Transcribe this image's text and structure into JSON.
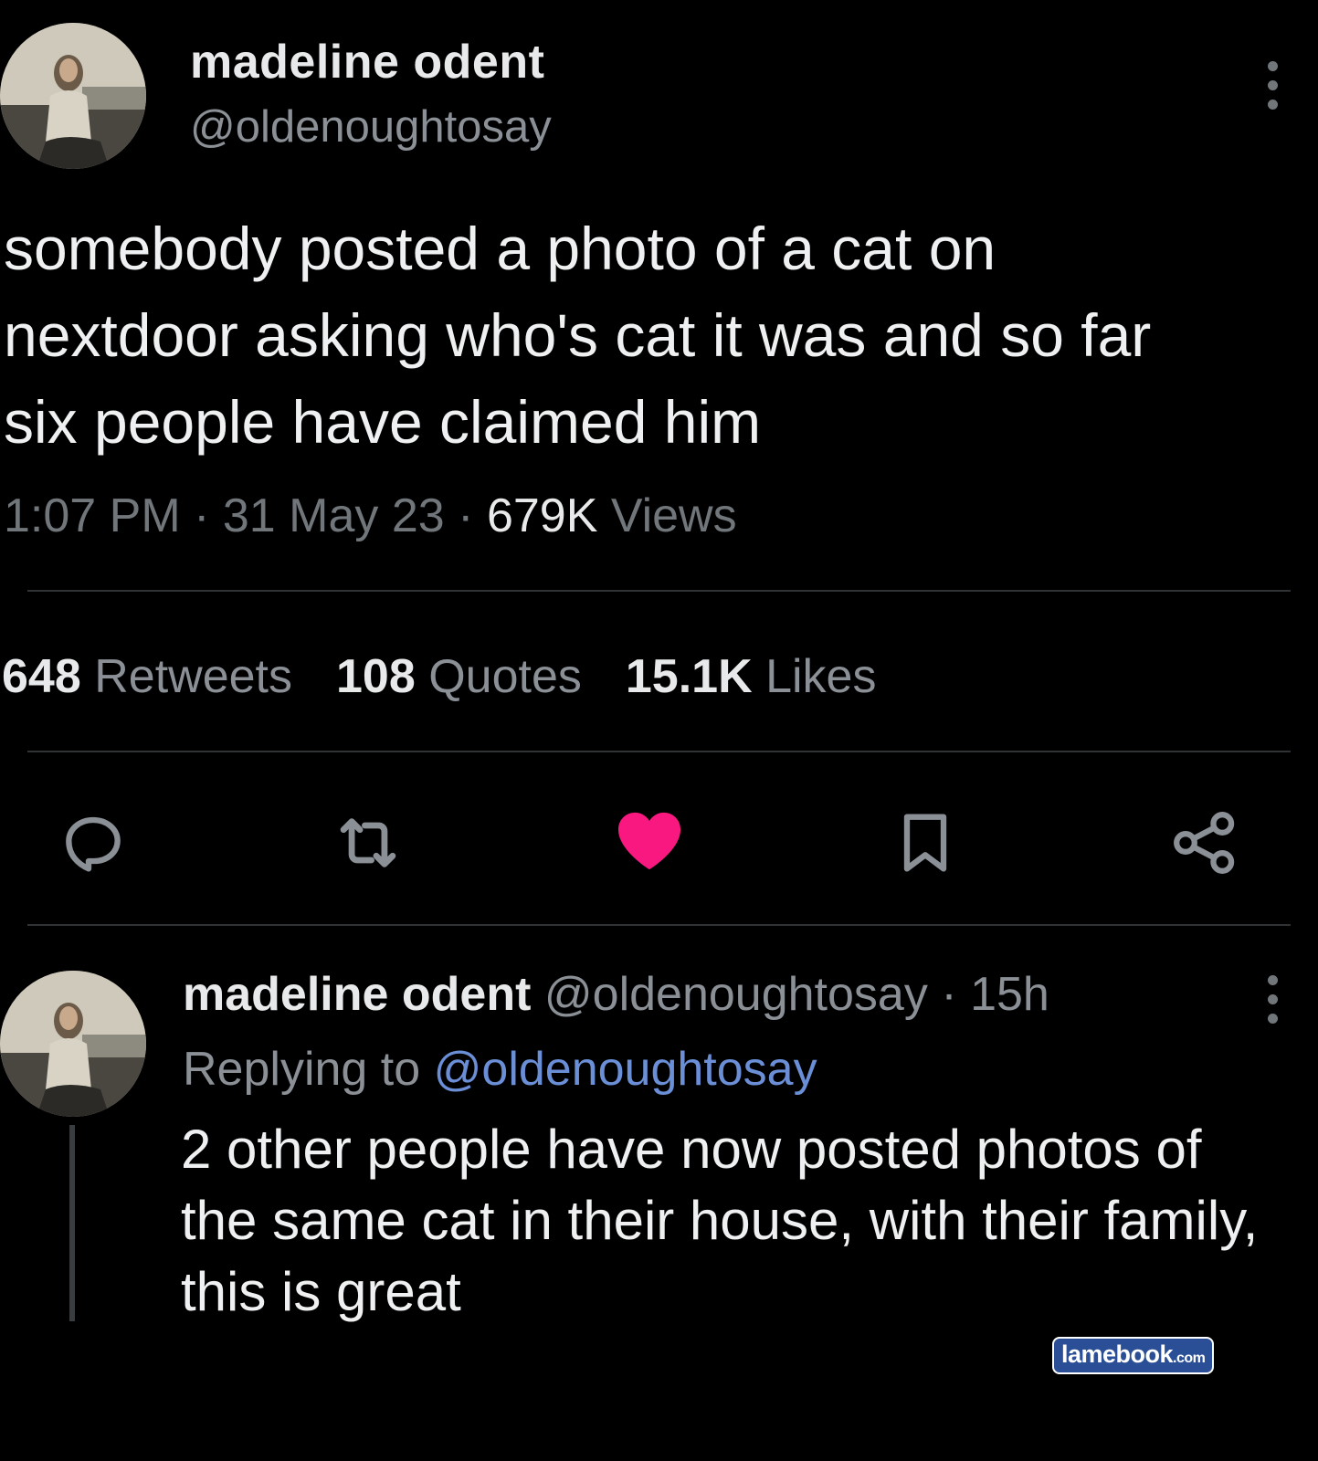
{
  "tweet": {
    "author_name": "madeline odent",
    "author_handle": "@oldenoughtosay",
    "text_lines": [
      "somebody posted a photo of a cat on",
      "nextdoor asking who's cat it was and so far",
      "six people have claimed him"
    ],
    "time": "1:07 PM",
    "date": "31 May 23",
    "views_count": "679K",
    "views_label": "Views",
    "separator": "·"
  },
  "stats": {
    "retweets_count": "648",
    "retweets_label": "Retweets",
    "quotes_count": "108",
    "quotes_label": "Quotes",
    "likes_count": "15.1K",
    "likes_label": "Likes"
  },
  "actions": {
    "icons": [
      "reply-icon",
      "retweet-icon",
      "heart-icon",
      "bookmark-icon",
      "share-icon"
    ],
    "liked": true,
    "liked_color": "#f91880",
    "icon_color": "#8b9096"
  },
  "reply": {
    "author_name": "madeline odent",
    "author_handle": "@oldenoughtosay",
    "time_ago": "· 15h",
    "replying_prefix": "Replying to",
    "replying_handle": "@oldenoughtosay",
    "text_lines": [
      "2 other people have now posted photos of",
      "the same cat in their house, with their family,",
      "this is great"
    ]
  },
  "watermark": {
    "text": "lamebook",
    "suffix": ".com"
  }
}
